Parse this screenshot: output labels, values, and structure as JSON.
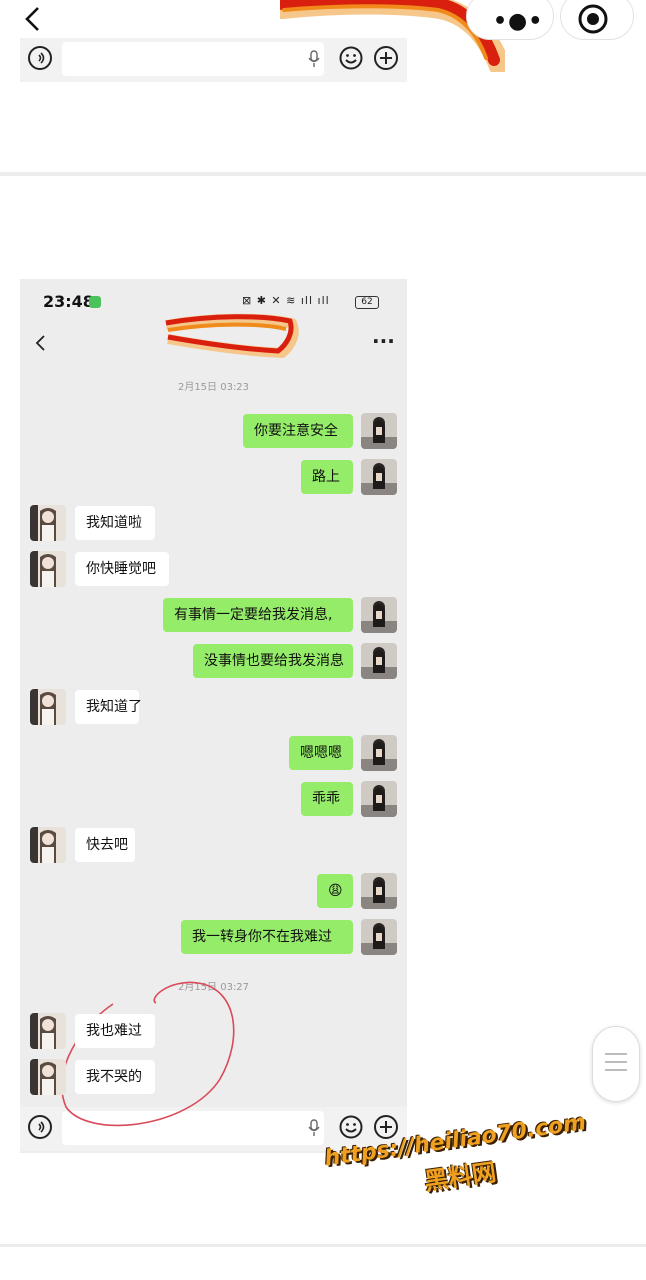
{
  "phone": {
    "status": {
      "time": "23:48",
      "battery": "62"
    },
    "chat": {
      "timestamps": [
        "2月15日 03:23",
        "2月15日 03:27"
      ],
      "messages": [
        {
          "side": "right",
          "text": "你要注意安全"
        },
        {
          "side": "right",
          "text": "路上"
        },
        {
          "side": "left",
          "text": "我知道啦"
        },
        {
          "side": "left",
          "text": "你快睡觉吧"
        },
        {
          "side": "right",
          "text": "有事情一定要给我发消息,"
        },
        {
          "side": "right",
          "text": "没事情也要给我发消息"
        },
        {
          "side": "left",
          "text": "我知道了"
        },
        {
          "side": "right",
          "text": "嗯嗯嗯"
        },
        {
          "side": "right",
          "text": "乖乖"
        },
        {
          "side": "left",
          "text": "快去吧"
        },
        {
          "side": "right",
          "text": "😩"
        },
        {
          "side": "right",
          "text": "我一转身你不在我难过"
        },
        {
          "side": "left",
          "text": "我也难过"
        },
        {
          "side": "left",
          "text": "我不哭的"
        }
      ]
    }
  },
  "watermark": {
    "url": "https://heiliao70.com",
    "name": "黑料网"
  },
  "icons": {
    "top_back": "chevron-left-icon",
    "top_more": "more-dots-icon",
    "top_target": "target-icon",
    "voice": "voice-icon",
    "mic": "mic-icon",
    "emoji": "emoji-icon",
    "plus": "plus-icon"
  },
  "colors": {
    "bubble_right": "#95ec69",
    "bubble_left": "#ffffff",
    "chat_bg": "#ededed",
    "wechat_green": "#4cc35a"
  }
}
